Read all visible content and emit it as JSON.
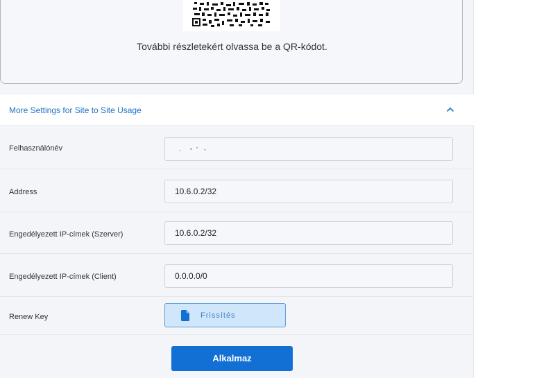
{
  "qr": {
    "caption": "További részletekért olvassa be a QR-kódot."
  },
  "section": {
    "title": "More Settings for Site to Site Usage",
    "expanded": true
  },
  "fields": [
    {
      "label": "Felhasználónév",
      "value": ""
    },
    {
      "label": "Address",
      "value": "10.6.0.2/32"
    },
    {
      "label": "Engedélyezett IP-címek (Szerver)",
      "value": "10.6.0.2/32"
    },
    {
      "label": "Engedélyezett IP-címek (Client)",
      "value": "0.0.0.0/0"
    }
  ],
  "renew": {
    "label": "Renew Key",
    "button_label": "Frissítés",
    "icon": "file-icon"
  },
  "apply": {
    "label": "Alkalmaz"
  },
  "colors": {
    "accent": "#1270d4",
    "link": "#1f72c4",
    "renew_bg": "#cfe6fb",
    "renew_border": "#5e9ddb",
    "panel_bg": "#f3f5f9"
  }
}
